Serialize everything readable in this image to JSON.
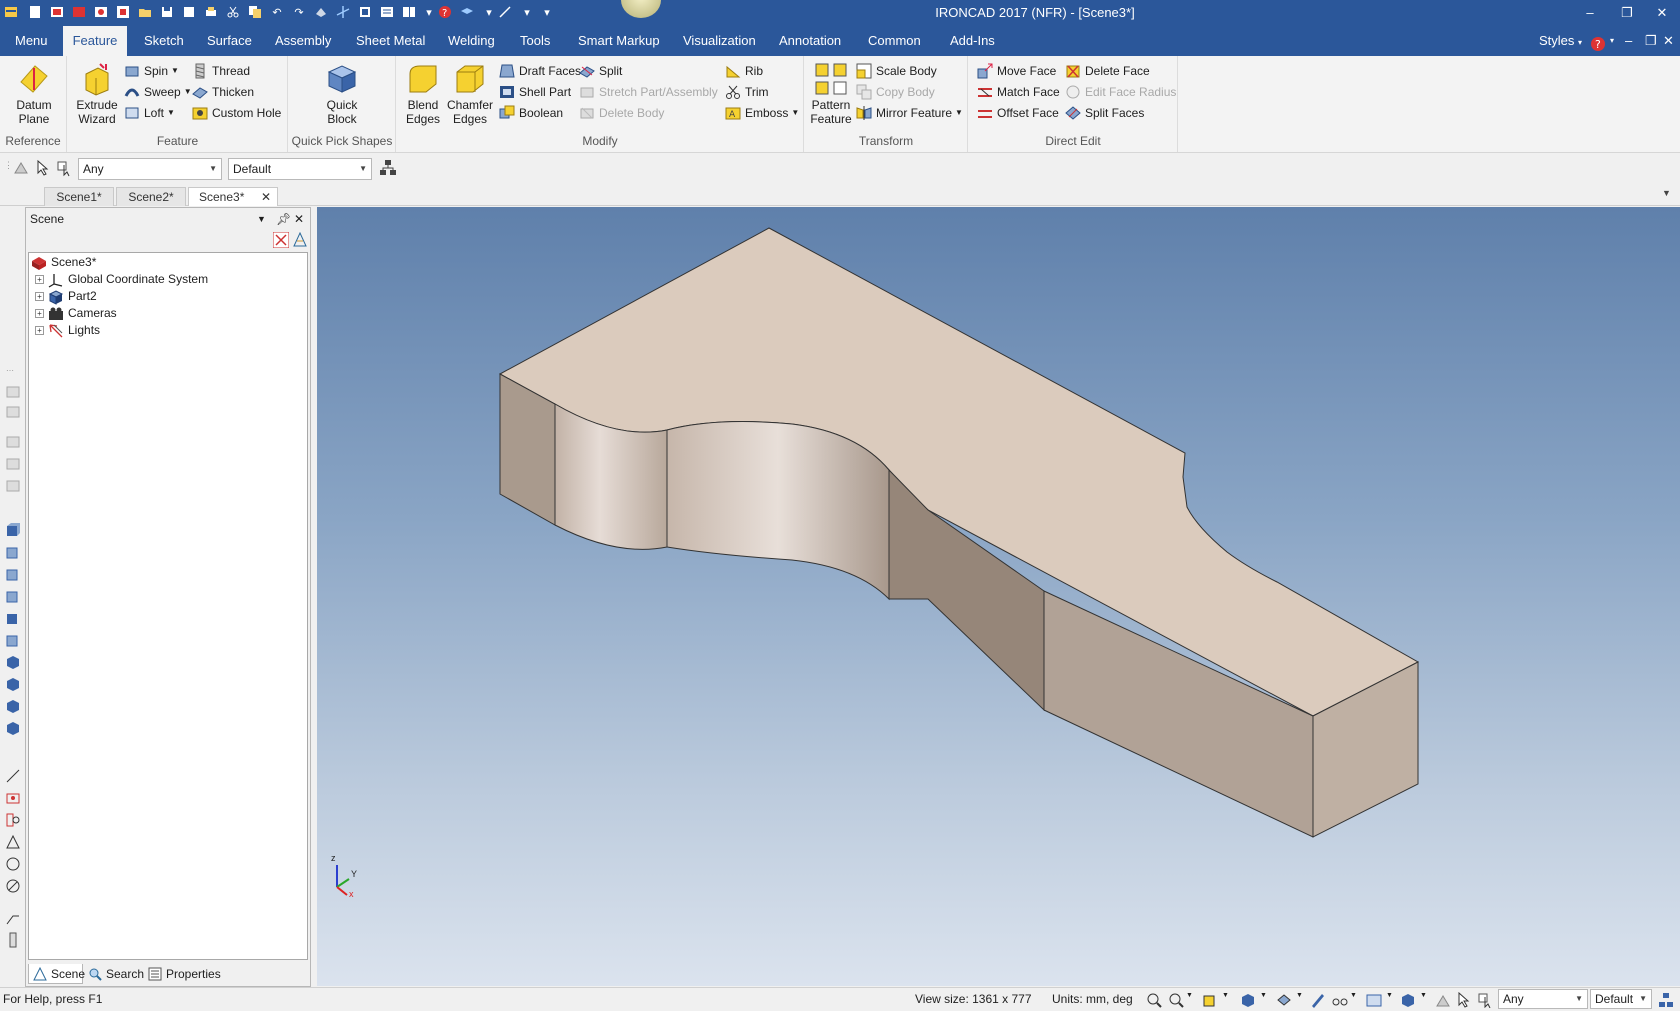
{
  "app": {
    "title": "IRONCAD 2017 (NFR) - [Scene3*]"
  },
  "window_controls": {
    "minimize": "–",
    "restore": "❐",
    "close": "✕"
  },
  "ribbon_tabs": [
    "Menu",
    "Feature",
    "Sketch",
    "Surface",
    "Assembly",
    "Sheet Metal",
    "Welding",
    "Tools",
    "Smart Markup",
    "Visualization",
    "Annotation",
    "Common",
    "Add-Ins"
  ],
  "active_tab": "Feature",
  "ribbon_right": {
    "styles": "Styles"
  },
  "groups": {
    "reference": {
      "label": "Reference",
      "datum_plane": "Datum\nPlane"
    },
    "feature": {
      "label": "Feature",
      "extrude_wizard": "Extrude\nWizard",
      "spin": "Spin",
      "sweep": "Sweep",
      "loft": "Loft",
      "thread": "Thread",
      "thicken": "Thicken",
      "custom_hole": "Custom Hole"
    },
    "quick_pick": {
      "label": "Quick Pick Shapes",
      "quick_block": "Quick\nBlock"
    },
    "modify": {
      "label": "Modify",
      "blend_edges": "Blend\nEdges",
      "chamfer_edges": "Chamfer\nEdges",
      "draft_faces": "Draft Faces",
      "shell_part": "Shell Part",
      "boolean": "Boolean",
      "split": "Split",
      "stretch": "Stretch Part/Assembly",
      "delete_body": "Delete Body",
      "rib": "Rib",
      "trim": "Trim",
      "emboss": "Emboss"
    },
    "transform": {
      "label": "Transform",
      "pattern_feature": "Pattern\nFeature",
      "scale_body": "Scale Body",
      "copy_body": "Copy Body",
      "mirror_feature": "Mirror Feature"
    },
    "direct_edit": {
      "label": "Direct Edit",
      "move_face": "Move Face",
      "match_face": "Match Face",
      "offset_face": "Offset Face",
      "delete_face": "Delete Face",
      "edit_face_radius": "Edit Face Radius",
      "split_faces": "Split Faces"
    }
  },
  "selection_toolbar": {
    "filter_value": "Any",
    "style_value": "Default"
  },
  "doc_tabs": [
    "Scene1*",
    "Scene2*",
    "Scene3*"
  ],
  "active_doc": "Scene3*",
  "scene_panel": {
    "title": "Scene",
    "tree": [
      {
        "label": "Scene3*",
        "icon": "scene-icon"
      },
      {
        "label": "Global Coordinate System",
        "icon": "coordinate-system-icon"
      },
      {
        "label": "Part2",
        "icon": "part-icon"
      },
      {
        "label": "Cameras",
        "icon": "camera-icon"
      },
      {
        "label": "Lights",
        "icon": "light-icon"
      }
    ],
    "bottom_tabs": [
      "Scene",
      "Search",
      "Properties"
    ]
  },
  "triad": {
    "z": "z",
    "y": "Y",
    "x": "x"
  },
  "status": {
    "help": "For Help, press F1",
    "view_size": "View size: 1361 x  777",
    "units": "Units: mm, deg",
    "filter": "Any",
    "style": "Default"
  },
  "colors": {
    "title_blue": "#2b579a",
    "part_top": "#dbcbbd",
    "part_side": "#a89a8d"
  }
}
